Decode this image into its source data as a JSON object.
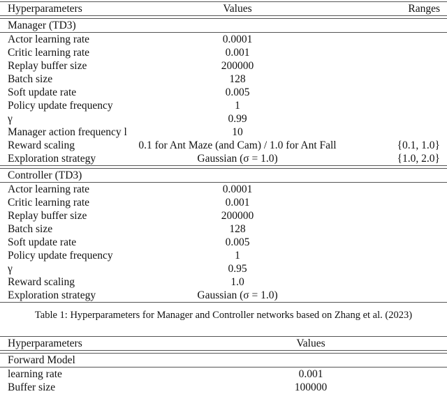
{
  "table1": {
    "headers": [
      "Hyperparameters",
      "Values",
      "Ranges"
    ],
    "sections": [
      {
        "title": "Manager (TD3)",
        "rows": [
          {
            "name": "Actor learning rate",
            "value": "0.0001",
            "range": ""
          },
          {
            "name": "Critic learning rate",
            "value": "0.001",
            "range": ""
          },
          {
            "name": "Replay buffer size",
            "value": "200000",
            "range": ""
          },
          {
            "name": "Batch size",
            "value": "128",
            "range": ""
          },
          {
            "name": "Soft update rate",
            "value": "0.005",
            "range": ""
          },
          {
            "name": "Policy update frequency",
            "value": "1",
            "range": ""
          },
          {
            "name": "γ",
            "value": "0.99",
            "range": ""
          },
          {
            "name": "Manager action frequency l",
            "value": "10",
            "range": ""
          },
          {
            "name": "Reward scaling",
            "value": "0.1 for Ant Maze (and Cam) / 1.0 for Ant Fall",
            "range": "{0.1, 1.0}"
          },
          {
            "name": "Exploration strategy",
            "value": "Gaussian (σ = 1.0)",
            "range": "{1.0, 2.0}"
          }
        ]
      },
      {
        "title": "Controller (TD3)",
        "rows": [
          {
            "name": "Actor learning rate",
            "value": "0.0001",
            "range": ""
          },
          {
            "name": "Critic learning rate",
            "value": "0.001",
            "range": ""
          },
          {
            "name": "Replay buffer size",
            "value": "200000",
            "range": ""
          },
          {
            "name": "Batch size",
            "value": "128",
            "range": ""
          },
          {
            "name": "Soft update rate",
            "value": "0.005",
            "range": ""
          },
          {
            "name": "Policy update frequency",
            "value": "1",
            "range": ""
          },
          {
            "name": "γ",
            "value": "0.95",
            "range": ""
          },
          {
            "name": "Reward scaling",
            "value": "1.0",
            "range": ""
          },
          {
            "name": "Exploration strategy",
            "value": "Gaussian (σ = 1.0)",
            "range": ""
          }
        ]
      }
    ],
    "caption": "Table 1: Hyperparameters for Manager and Controller networks based on Zhang et al. (2023)"
  },
  "table2": {
    "headers": [
      "Hyperparameters",
      "Values"
    ],
    "section_title": "Forward Model",
    "rows": [
      {
        "name": "learning rate",
        "value": "0.001"
      },
      {
        "name": "Buffer size",
        "value": "100000"
      }
    ]
  }
}
